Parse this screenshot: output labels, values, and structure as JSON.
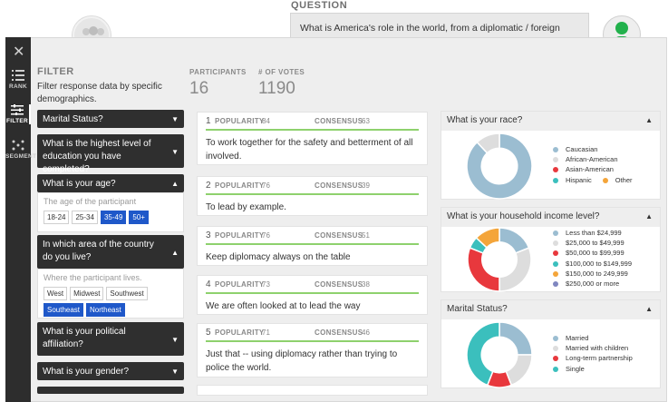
{
  "question": {
    "label": "QUESTION",
    "text": "What is America's role in the world, from a diplomatic / foreign policy perspective?"
  },
  "rail": {
    "items": [
      {
        "label": "RANK",
        "icon": "list-icon"
      },
      {
        "label": "FILTER",
        "icon": "sliders-icon"
      },
      {
        "label": "SEGMENT",
        "icon": "segment-icon"
      }
    ]
  },
  "filter": {
    "title": "FILTER",
    "description": "Filter response data by specific demographics.",
    "sections": [
      {
        "label": "Marital Status?",
        "expanded": false
      },
      {
        "label": "What is the highest level of education you have completed?",
        "expanded": false
      },
      {
        "label": "What is your age?",
        "expanded": true,
        "hint": "The age of the participant",
        "chips": [
          {
            "label": "18-24",
            "selected": false
          },
          {
            "label": "25-34",
            "selected": false
          },
          {
            "label": "35-49",
            "selected": true
          },
          {
            "label": "50+",
            "selected": true
          }
        ]
      },
      {
        "label": "In which area of the country do you live?",
        "expanded": true,
        "hint": "Where the participant lives.",
        "chips": [
          {
            "label": "West",
            "selected": false
          },
          {
            "label": "Midwest",
            "selected": false
          },
          {
            "label": "Southwest",
            "selected": false
          },
          {
            "label": "Southeast",
            "selected": true
          },
          {
            "label": "Northeast",
            "selected": true
          }
        ]
      },
      {
        "label": "What is your political affiliation?",
        "expanded": false
      },
      {
        "label": "What is your gender?",
        "expanded": false
      }
    ]
  },
  "stats": {
    "participants_label": "PARTICIPANTS",
    "participants_value": "16",
    "votes_label": "# OF VOTES",
    "votes_value": "1190"
  },
  "answers": [
    {
      "rank": "1",
      "pop_label": "POPULARITY",
      "popularity": "84",
      "con_label": "CONSENSUS",
      "consensus": "63",
      "text": "To work together for the safety and betterment of all involved."
    },
    {
      "rank": "2",
      "pop_label": "POPULARITY",
      "popularity": "76",
      "con_label": "CONSENSUS",
      "consensus": "39",
      "text": "To lead by example."
    },
    {
      "rank": "3",
      "pop_label": "POPULARITY",
      "popularity": "76",
      "con_label": "CONSENSUS",
      "consensus": "51",
      "text": "Keep diplomacy always on the table"
    },
    {
      "rank": "4",
      "pop_label": "POPULARITY",
      "popularity": "73",
      "con_label": "CONSENSUS",
      "consensus": "38",
      "text": "We are often looked at to lead the way"
    },
    {
      "rank": "5",
      "pop_label": "POPULARITY",
      "popularity": "71",
      "con_label": "CONSENSUS",
      "consensus": "46",
      "text": "Just that -- using diplomacy rather than trying to police the world."
    }
  ],
  "charts": [
    {
      "title": "What is your race?",
      "slices": [
        {
          "label": "Caucasian",
          "value": 88,
          "color": "#9bbdd1"
        },
        {
          "label": "African-American",
          "value": 12,
          "color": "#dddddd"
        },
        {
          "label": "Asian-American",
          "value": 0,
          "color": "#e8383d"
        },
        {
          "label": "Hispanic",
          "value": 0,
          "color": "#3bbfbd"
        },
        {
          "label": "Other",
          "value": 0,
          "color": "#f4a53a"
        }
      ]
    },
    {
      "title": "What is your household income level?",
      "slices": [
        {
          "label": "Less than $24,999",
          "value": 19,
          "color": "#9bbdd1"
        },
        {
          "label": "$25,000 to $49,999",
          "value": 31,
          "color": "#dddddd"
        },
        {
          "label": "$50,000 to $99,999",
          "value": 31,
          "color": "#e8383d"
        },
        {
          "label": "$100,000 to $149,999",
          "value": 6,
          "color": "#3bbfbd"
        },
        {
          "label": "$150,000 to 249,999",
          "value": 13,
          "color": "#f4a53a"
        },
        {
          "label": "$250,000 or more",
          "value": 0,
          "color": "#7f86c0"
        }
      ]
    },
    {
      "title": "Marital Status?",
      "slices": [
        {
          "label": "Married",
          "value": 25,
          "color": "#9bbdd1"
        },
        {
          "label": "Married with children",
          "value": 19,
          "color": "#dddddd"
        },
        {
          "label": "Long-term partnership",
          "value": 12,
          "color": "#e8383d"
        },
        {
          "label": "Single",
          "value": 44,
          "color": "#3bbfbd"
        }
      ]
    }
  ]
}
